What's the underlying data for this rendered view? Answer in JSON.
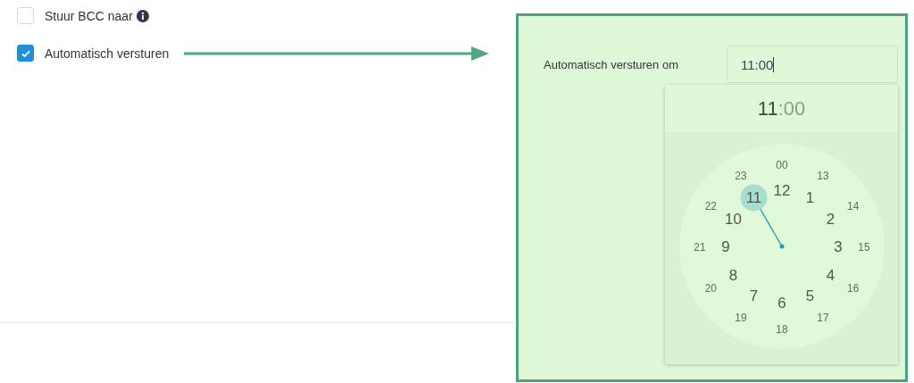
{
  "options": [
    {
      "label": "Stuur BCC naar",
      "checked": false,
      "info": true
    },
    {
      "label": "Automatisch versturen",
      "checked": true,
      "info": false
    }
  ],
  "time_setting": {
    "label": "Automatisch versturen om",
    "value": "11:00",
    "picker": {
      "hours": "11",
      "minutes": ":00",
      "inner_ring": [
        {
          "label": "12",
          "selected": false
        },
        {
          "label": "1",
          "selected": false
        },
        {
          "label": "2",
          "selected": false
        },
        {
          "label": "3",
          "selected": false
        },
        {
          "label": "4",
          "selected": false
        },
        {
          "label": "5",
          "selected": false
        },
        {
          "label": "6",
          "selected": false
        },
        {
          "label": "7",
          "selected": false
        },
        {
          "label": "8",
          "selected": false
        },
        {
          "label": "9",
          "selected": false
        },
        {
          "label": "10",
          "selected": false
        },
        {
          "label": "11",
          "selected": true
        }
      ],
      "outer_ring": [
        {
          "label": "00",
          "selected": false
        },
        {
          "label": "13",
          "selected": false
        },
        {
          "label": "14",
          "selected": false
        },
        {
          "label": "15",
          "selected": false
        },
        {
          "label": "16",
          "selected": false
        },
        {
          "label": "17",
          "selected": false
        },
        {
          "label": "18",
          "selected": false
        },
        {
          "label": "19",
          "selected": false
        },
        {
          "label": "20",
          "selected": false
        },
        {
          "label": "21",
          "selected": false
        },
        {
          "label": "22",
          "selected": false
        },
        {
          "label": "23",
          "selected": false
        }
      ]
    }
  }
}
